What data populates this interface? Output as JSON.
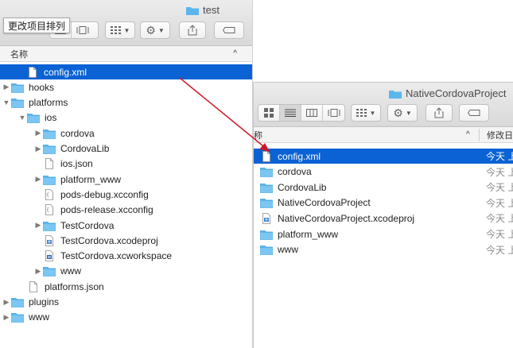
{
  "left_window": {
    "title": "test",
    "tooltip": "更改项目排列",
    "column_name": "名称",
    "sort_indicator": "^",
    "rows": [
      {
        "label": "config.xml",
        "icon": "document-icon",
        "selected": true
      },
      {
        "label": "hooks",
        "icon": "folder-icon"
      },
      {
        "label": "platforms",
        "icon": "folder-icon"
      },
      {
        "label": "ios",
        "icon": "folder-icon"
      },
      {
        "label": "cordova",
        "icon": "folder-icon"
      },
      {
        "label": "CordovaLib",
        "icon": "folder-icon"
      },
      {
        "label": "ios.json",
        "icon": "document-icon"
      },
      {
        "label": "platform_www",
        "icon": "folder-icon"
      },
      {
        "label": "pods-debug.xcconfig",
        "icon": "config-file-icon"
      },
      {
        "label": "pods-release.xcconfig",
        "icon": "config-file-icon"
      },
      {
        "label": "TestCordova",
        "icon": "folder-icon"
      },
      {
        "label": "TestCordova.xcodeproj",
        "icon": "xcodeproj-icon"
      },
      {
        "label": "TestCordova.xcworkspace",
        "icon": "xcworkspace-icon"
      },
      {
        "label": "www",
        "icon": "folder-icon"
      },
      {
        "label": "platforms.json",
        "icon": "document-icon"
      },
      {
        "label": "plugins",
        "icon": "folder-icon"
      },
      {
        "label": "www",
        "icon": "folder-icon"
      }
    ]
  },
  "right_window": {
    "title": "NativeCordovaProject",
    "column_name": "称",
    "sort_indicator": "^",
    "column_modified": "修改日",
    "rows": [
      {
        "label": "config.xml",
        "date": "今天 上",
        "icon": "document-icon",
        "selected": true
      },
      {
        "label": "cordova",
        "date": "今天 上",
        "icon": "folder-icon"
      },
      {
        "label": "CordovaLib",
        "date": "今天 上",
        "icon": "folder-icon"
      },
      {
        "label": "NativeCordovaProject",
        "date": "今天 上",
        "icon": "folder-icon"
      },
      {
        "label": "NativeCordovaProject.xcodeproj",
        "date": "今天 上",
        "icon": "xcodeproj-icon"
      },
      {
        "label": "platform_www",
        "date": "今天 上",
        "icon": "folder-icon"
      },
      {
        "label": "www",
        "date": "今天 上",
        "icon": "folder-icon"
      }
    ]
  },
  "colors": {
    "selection": "#0a62d4",
    "folder": "#5bb6ee",
    "arrow": "#cc1a28"
  }
}
